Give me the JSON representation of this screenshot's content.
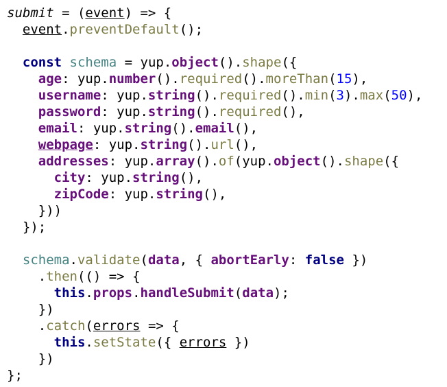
{
  "colors": {
    "background": "#ffffff",
    "keyword": "#000080",
    "property": "#660e7a",
    "function": "#7a7a43",
    "number": "#0000ff",
    "variable": "#458383",
    "text": "#000000"
  },
  "code_lines": [
    [
      {
        "t": "submit",
        "c": "text",
        "s": [
          "italic"
        ]
      },
      {
        "t": " = (",
        "c": "text"
      },
      {
        "t": "event",
        "c": "text",
        "s": [
          "ul"
        ]
      },
      {
        "t": ") => {",
        "c": "text"
      }
    ],
    [
      {
        "t": "  ",
        "c": "text"
      },
      {
        "t": "event",
        "c": "text",
        "s": [
          "ul"
        ]
      },
      {
        "t": ".",
        "c": "text"
      },
      {
        "t": "preventDefault",
        "c": "fn"
      },
      {
        "t": "();",
        "c": "text"
      }
    ],
    [],
    [
      {
        "t": "  ",
        "c": "text"
      },
      {
        "t": "const",
        "c": "kw"
      },
      {
        "t": " ",
        "c": "text"
      },
      {
        "t": "schema",
        "c": "var"
      },
      {
        "t": " = yup.",
        "c": "text"
      },
      {
        "t": "object",
        "c": "prop"
      },
      {
        "t": "().",
        "c": "text"
      },
      {
        "t": "shape",
        "c": "fn"
      },
      {
        "t": "({",
        "c": "text"
      }
    ],
    [
      {
        "t": "    ",
        "c": "text"
      },
      {
        "t": "age",
        "c": "prop"
      },
      {
        "t": ": yup.",
        "c": "text"
      },
      {
        "t": "number",
        "c": "prop"
      },
      {
        "t": "().",
        "c": "text"
      },
      {
        "t": "required",
        "c": "fn"
      },
      {
        "t": "().",
        "c": "text"
      },
      {
        "t": "moreThan",
        "c": "fn"
      },
      {
        "t": "(",
        "c": "text"
      },
      {
        "t": "15",
        "c": "num"
      },
      {
        "t": "),",
        "c": "text"
      }
    ],
    [
      {
        "t": "    ",
        "c": "text"
      },
      {
        "t": "username",
        "c": "prop"
      },
      {
        "t": ": yup.",
        "c": "text"
      },
      {
        "t": "string",
        "c": "prop"
      },
      {
        "t": "().",
        "c": "text"
      },
      {
        "t": "required",
        "c": "fn"
      },
      {
        "t": "().",
        "c": "text"
      },
      {
        "t": "min",
        "c": "fn"
      },
      {
        "t": "(",
        "c": "text"
      },
      {
        "t": "3",
        "c": "num"
      },
      {
        "t": ").",
        "c": "text"
      },
      {
        "t": "max",
        "c": "fn"
      },
      {
        "t": "(",
        "c": "text"
      },
      {
        "t": "50",
        "c": "num"
      },
      {
        "t": "),",
        "c": "text"
      }
    ],
    [
      {
        "t": "    ",
        "c": "text"
      },
      {
        "t": "password",
        "c": "prop"
      },
      {
        "t": ": yup.",
        "c": "text"
      },
      {
        "t": "string",
        "c": "prop"
      },
      {
        "t": "().",
        "c": "text"
      },
      {
        "t": "required",
        "c": "fn"
      },
      {
        "t": "(),",
        "c": "text"
      }
    ],
    [
      {
        "t": "    ",
        "c": "text"
      },
      {
        "t": "email",
        "c": "prop"
      },
      {
        "t": ": yup.",
        "c": "text"
      },
      {
        "t": "string",
        "c": "prop"
      },
      {
        "t": "().",
        "c": "text"
      },
      {
        "t": "email",
        "c": "prop"
      },
      {
        "t": "(),",
        "c": "text"
      }
    ],
    [
      {
        "t": "    ",
        "c": "text"
      },
      {
        "t": "webpage",
        "c": "prop",
        "s": [
          "ul"
        ]
      },
      {
        "t": ": yup.",
        "c": "text"
      },
      {
        "t": "string",
        "c": "prop"
      },
      {
        "t": "().",
        "c": "text"
      },
      {
        "t": "url",
        "c": "fn"
      },
      {
        "t": "(),",
        "c": "text"
      }
    ],
    [
      {
        "t": "    ",
        "c": "text"
      },
      {
        "t": "addresses",
        "c": "prop"
      },
      {
        "t": ": yup.",
        "c": "text"
      },
      {
        "t": "array",
        "c": "prop"
      },
      {
        "t": "().",
        "c": "text"
      },
      {
        "t": "of",
        "c": "fn"
      },
      {
        "t": "(yup.",
        "c": "text"
      },
      {
        "t": "object",
        "c": "prop"
      },
      {
        "t": "().",
        "c": "text"
      },
      {
        "t": "shape",
        "c": "fn"
      },
      {
        "t": "({",
        "c": "text"
      }
    ],
    [
      {
        "t": "      ",
        "c": "text"
      },
      {
        "t": "city",
        "c": "prop"
      },
      {
        "t": ": yup.",
        "c": "text"
      },
      {
        "t": "string",
        "c": "prop"
      },
      {
        "t": "(),",
        "c": "text"
      }
    ],
    [
      {
        "t": "      ",
        "c": "text"
      },
      {
        "t": "zipCode",
        "c": "prop"
      },
      {
        "t": ": yup.",
        "c": "text"
      },
      {
        "t": "string",
        "c": "prop"
      },
      {
        "t": "(),",
        "c": "text"
      }
    ],
    [
      {
        "t": "    }))",
        "c": "text"
      }
    ],
    [
      {
        "t": "  });",
        "c": "text"
      }
    ],
    [],
    [
      {
        "t": "  ",
        "c": "text"
      },
      {
        "t": "schema",
        "c": "var"
      },
      {
        "t": ".",
        "c": "text"
      },
      {
        "t": "validate",
        "c": "fn"
      },
      {
        "t": "(",
        "c": "text"
      },
      {
        "t": "data",
        "c": "prop"
      },
      {
        "t": ", { ",
        "c": "text"
      },
      {
        "t": "abortEarly",
        "c": "prop"
      },
      {
        "t": ": ",
        "c": "text"
      },
      {
        "t": "false",
        "c": "kw"
      },
      {
        "t": " })",
        "c": "text"
      }
    ],
    [
      {
        "t": "    .",
        "c": "text"
      },
      {
        "t": "then",
        "c": "fn"
      },
      {
        "t": "(() => {",
        "c": "text"
      }
    ],
    [
      {
        "t": "      ",
        "c": "text"
      },
      {
        "t": "this",
        "c": "kw"
      },
      {
        "t": ".",
        "c": "text"
      },
      {
        "t": "props",
        "c": "prop"
      },
      {
        "t": ".",
        "c": "text"
      },
      {
        "t": "handleSubmit",
        "c": "prop"
      },
      {
        "t": "(",
        "c": "text"
      },
      {
        "t": "data",
        "c": "prop"
      },
      {
        "t": ");",
        "c": "text"
      }
    ],
    [
      {
        "t": "    })",
        "c": "text"
      }
    ],
    [
      {
        "t": "    .",
        "c": "text"
      },
      {
        "t": "catch",
        "c": "fn"
      },
      {
        "t": "(",
        "c": "text"
      },
      {
        "t": "errors",
        "c": "text",
        "s": [
          "ul"
        ]
      },
      {
        "t": " => {",
        "c": "text"
      }
    ],
    [
      {
        "t": "      ",
        "c": "text"
      },
      {
        "t": "this",
        "c": "kw"
      },
      {
        "t": ".",
        "c": "text"
      },
      {
        "t": "setState",
        "c": "fn"
      },
      {
        "t": "({ ",
        "c": "text"
      },
      {
        "t": "errors",
        "c": "text",
        "s": [
          "ul"
        ]
      },
      {
        "t": " })",
        "c": "text"
      }
    ],
    [
      {
        "t": "    })",
        "c": "text"
      }
    ],
    [
      {
        "t": "};",
        "c": "text"
      }
    ]
  ]
}
